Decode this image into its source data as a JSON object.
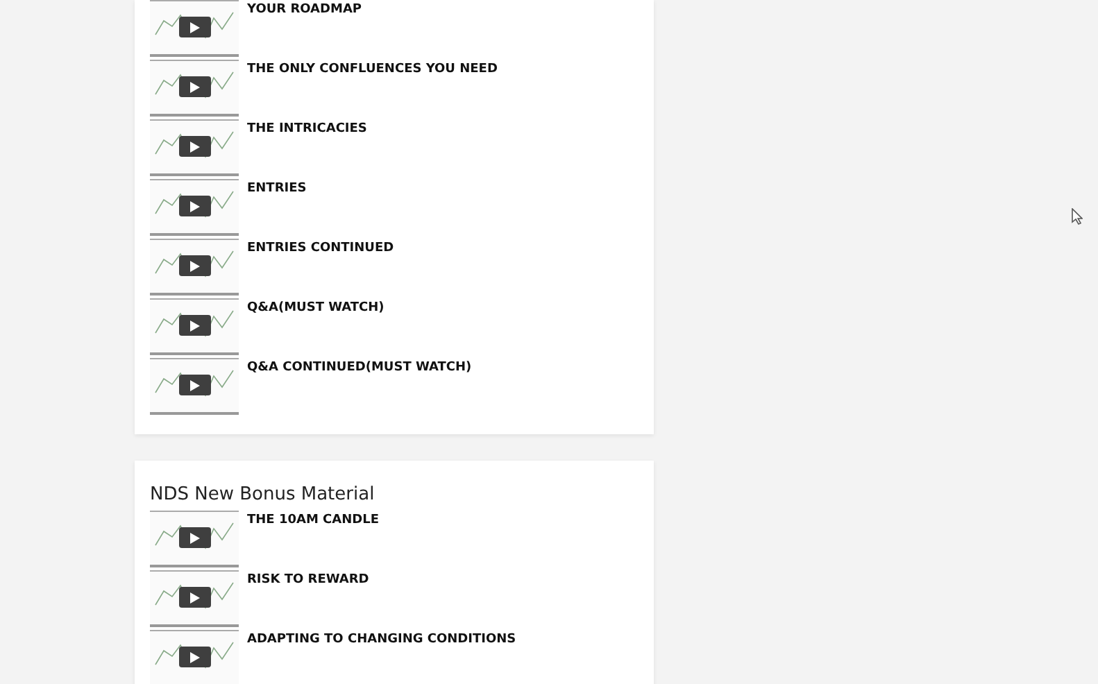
{
  "sections": [
    {
      "lessons": [
        {
          "title": "YOUR ROADMAP"
        },
        {
          "title": "THE ONLY CONFLUENCES YOU NEED"
        },
        {
          "title": "THE INTRICACIES"
        },
        {
          "title": "ENTRIES"
        },
        {
          "title": "ENTRIES CONTINUED"
        },
        {
          "title": "Q&A(MUST WATCH)"
        },
        {
          "title": "Q&A CONTINUED(MUST WATCH)"
        }
      ]
    },
    {
      "heading": "NDS New Bonus Material",
      "lessons": [
        {
          "title": "THE 10AM CANDLE"
        },
        {
          "title": "RISK TO REWARD"
        },
        {
          "title": "ADAPTING TO CHANGING CONDITIONS"
        }
      ]
    }
  ]
}
